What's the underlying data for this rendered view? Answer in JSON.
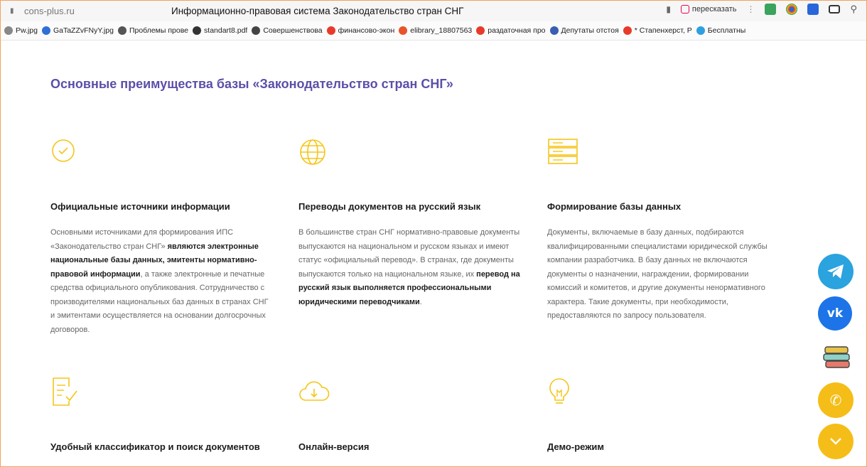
{
  "browser": {
    "domain": "cons-plus.ru",
    "page_title": "Информационно-правовая система Законодательство стран СНГ",
    "retell_label": "пересказать",
    "bookmarks": [
      {
        "label": "Pw.jpg",
        "color": "#888888"
      },
      {
        "label": "GaTaZZvFNyY.jpg",
        "color": "#2f6fd6"
      },
      {
        "label": "Проблемы прове",
        "color": "#555555"
      },
      {
        "label": "standart8.pdf",
        "color": "#333333"
      },
      {
        "label": "Совершенствова",
        "color": "#444444"
      },
      {
        "label": "финансово-экон",
        "color": "#e83a2a"
      },
      {
        "label": "elibrary_18807563",
        "color": "#e8542a"
      },
      {
        "label": "раздаточная про",
        "color": "#e83a2a"
      },
      {
        "label": "Депутаты отстоя",
        "color": "#3a5fb0"
      },
      {
        "label": "* Стапенхерст, Р",
        "color": "#e83a2a"
      },
      {
        "label": "Бесплатны",
        "color": "#2ea0e0"
      }
    ]
  },
  "main": {
    "heading": "Основные преимущества базы «Законодательство стран СНГ»",
    "features": [
      {
        "icon": "check-circle-icon",
        "title": "Официальные источники информации",
        "desc_parts": [
          {
            "t": "Основными источниками для формирования ИПС «Законодательство стран СНГ» ",
            "b": false
          },
          {
            "t": "являются электронные национальные базы данных, эмитенты нормативно-правовой информации",
            "b": true
          },
          {
            "t": ", а также электронные и печатные средства официального опубликования. Сотрудничество с производителями национальных баз данных в странах СНГ и эмитентами осуществляется на основании долгосрочных договоров.",
            "b": false
          }
        ]
      },
      {
        "icon": "globe-icon",
        "title": "Переводы документов на русский язык",
        "desc_parts": [
          {
            "t": "В большинстве стран СНГ нормативно-правовые документы выпускаются на национальном и русском языках и имеют статус «официальный перевод». В странах, где документы выпускаются только на национальном языке, их ",
            "b": false
          },
          {
            "t": "перевод на русский язык выполняется профессиональными юридическими переводчиками",
            "b": true
          },
          {
            "t": ".",
            "b": false
          }
        ]
      },
      {
        "icon": "database-icon",
        "title": "Формирование базы данных",
        "desc_parts": [
          {
            "t": "Документы, включаемые в базу данных, подбираются квалифицированными специалистами юридической службы компании разработчика. В базу данных не включаются документы о назначении, награждении, формировании комиссий и комитетов, и другие документы ненормативного характера. Такие документы, при необходимости, предоставляются по запросу пользователя.",
            "b": false
          }
        ]
      },
      {
        "icon": "document-check-icon",
        "title": "Удобный классификатор и поиск документов",
        "desc_parts": []
      },
      {
        "icon": "cloud-download-icon",
        "title": "Онлайн-версия",
        "desc_parts": []
      },
      {
        "icon": "lightbulb-icon",
        "title": "Демо-режим",
        "desc_parts": []
      }
    ]
  },
  "floating": [
    {
      "name": "telegram-button",
      "icon": "telegram-icon",
      "color": "#2aa3df"
    },
    {
      "name": "vk-button",
      "icon": "vk-icon",
      "color": "#1d74e8"
    },
    {
      "name": "books-button",
      "icon": "books-icon",
      "color": "#ffffff"
    },
    {
      "name": "call-button",
      "icon": "phone-icon",
      "color": "#f5bd17"
    },
    {
      "name": "scroll-down-button",
      "icon": "chevron-down-icon",
      "color": "#f5bd17"
    }
  ],
  "colors": {
    "accent": "#f5c518",
    "heading": "#5a4fa8"
  }
}
